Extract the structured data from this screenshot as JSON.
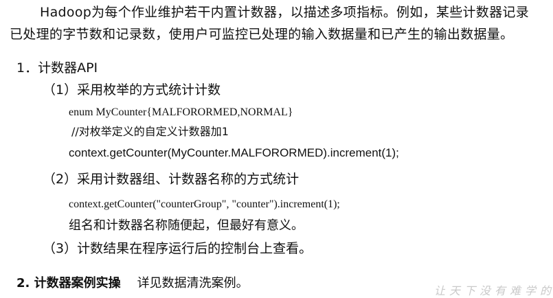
{
  "intro": {
    "line1": "Hadoop为每个作业维护若干内置计数器，以描述多项指标。例如，某些计数器记录",
    "line2": "已处理的字节数和记录数，使用户可监控已处理的输入数据量和已产生的输出数据量。"
  },
  "section1": {
    "heading": "1．计数器API",
    "sub1": {
      "title": "（1）采用枚举的方式统计计数",
      "code_enum": "enum MyCounter{MALFORORMED,NORMAL}",
      "code_comment": "//对枚举定义的自定义计数器加1",
      "code_call": "context.getCounter(MyCounter.MALFORORMED).increment(1);"
    },
    "sub2": {
      "title": "（2）采用计数器组、计数器名称的方式统计",
      "code_call": "context.getCounter(\"counterGroup\", \"counter\").increment(1);",
      "note": "组名和计数器名称随便起，但最好有意义。"
    },
    "sub3": {
      "title": "（3）计数结果在程序运行后的控制台上查看。"
    }
  },
  "section2": {
    "heading": "2. 计数器案例实操",
    "text": "详见数据清洗案例。"
  },
  "watermark": {
    "text": "让天下没有难学的技"
  }
}
